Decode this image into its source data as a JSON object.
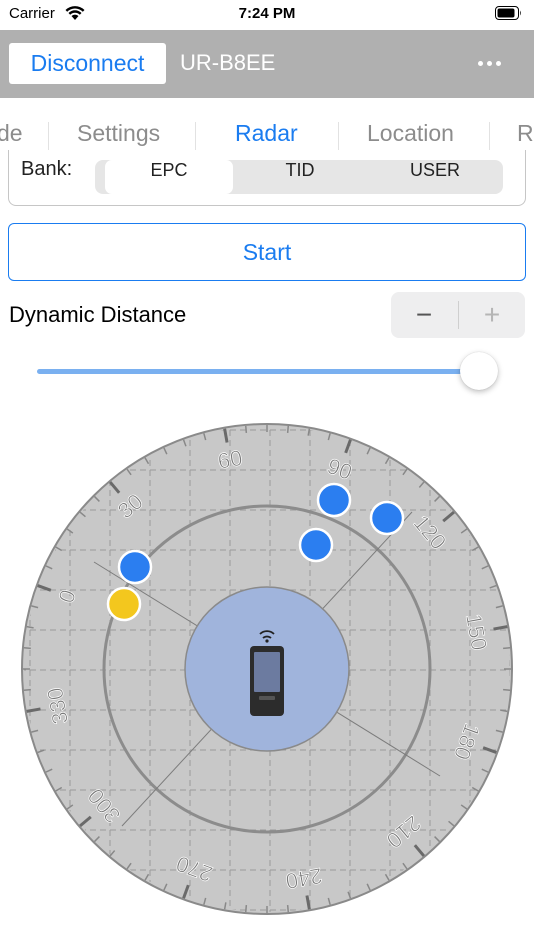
{
  "status": {
    "carrier": "Carrier",
    "time": "7:24 PM"
  },
  "nav": {
    "disconnect_label": "Disconnect",
    "device_name": "UR-B8EE"
  },
  "tabs": [
    {
      "label": "de"
    },
    {
      "label": "Settings"
    },
    {
      "label": "Radar",
      "active": true
    },
    {
      "label": "Location"
    },
    {
      "label": "R"
    }
  ],
  "bank": {
    "label": "Bank:",
    "options": [
      "EPC",
      "TID",
      "USER"
    ],
    "selected": "EPC"
  },
  "start_label": "Start",
  "dynamic_distance": {
    "label": "Dynamic Distance",
    "minus": "−",
    "plus": "+",
    "slider_level": 1.0
  },
  "radar": {
    "degree_labels": [
      "0",
      "30",
      "60",
      "90",
      "120",
      "150",
      "180",
      "210",
      "240",
      "270",
      "300",
      "330"
    ],
    "colors": {
      "target": "#2b7ef0",
      "highlight": "#f3c71e",
      "center": "#a0b4dc",
      "dial": "#c8c8c8"
    }
  }
}
